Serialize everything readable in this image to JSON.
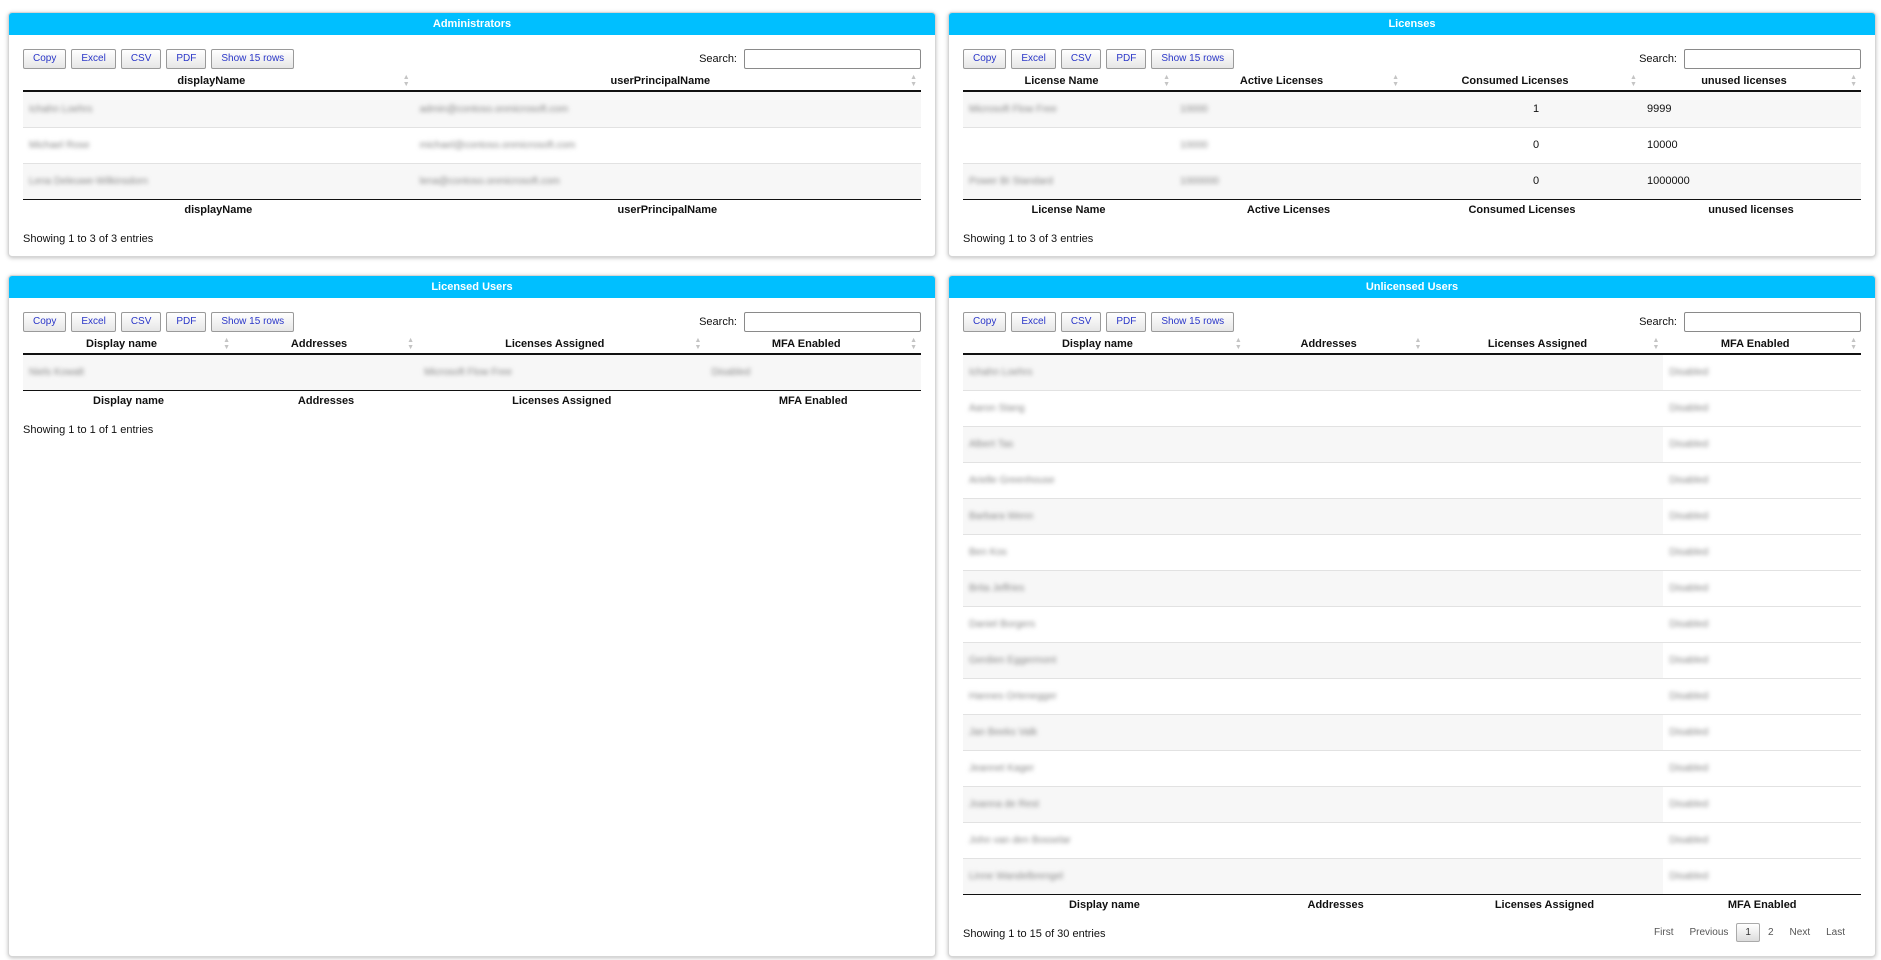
{
  "toolbar": {
    "copy": "Copy",
    "excel": "Excel",
    "csv": "CSV",
    "pdf": "PDF",
    "show_rows": "Show 15 rows",
    "search_label": "Search:"
  },
  "administrators": {
    "title": "Administrators",
    "columns": [
      "displayName",
      "userPrincipalName"
    ],
    "rows": [
      [
        "Ichahn Loehrs",
        "admin@contoso.onmicrosoft.com"
      ],
      [
        "Michael Rose",
        "michael@contoso.onmicrosoft.com"
      ],
      [
        "Lena Deleuwe-Wilkinsdorn",
        "lena@contoso.onmicrosoft.com"
      ]
    ],
    "info": "Showing 1 to 3 of 3 entries"
  },
  "licenses": {
    "title": "Licenses",
    "columns": [
      "License Name",
      "Active Licenses",
      "Consumed Licenses",
      "unused licenses"
    ],
    "rows": [
      [
        "Microsoft Flow Free",
        "10000",
        "1",
        "9999"
      ],
      [
        "",
        "10000",
        "0",
        "10000"
      ],
      [
        "Power BI Standard",
        "1000000",
        "0",
        "1000000"
      ]
    ],
    "info": "Showing 1 to 3 of 3 entries"
  },
  "licensed_users": {
    "title": "Licensed Users",
    "columns": [
      "Display name",
      "Addresses",
      "Licenses Assigned",
      "MFA Enabled"
    ],
    "rows": [
      [
        "Niels Kowalt",
        "",
        "Microsoft Flow Free",
        "Disabled"
      ]
    ],
    "info": "Showing 1 to 1 of 1 entries"
  },
  "unlicensed_users": {
    "title": "Unlicensed Users",
    "columns": [
      "Display name",
      "Addresses",
      "Licenses Assigned",
      "MFA Enabled"
    ],
    "rows": [
      [
        "Ichahn Loehrs",
        "",
        "",
        "Disabled"
      ],
      [
        "Aaron Stang",
        "",
        "",
        "Disabled"
      ],
      [
        "Albert Tas",
        "",
        "",
        "Disabled"
      ],
      [
        "Arielle Greenhouse",
        "",
        "",
        "Disabled"
      ],
      [
        "Barbara Wenn",
        "",
        "",
        "Disabled"
      ],
      [
        "Ben Kos",
        "",
        "",
        "Disabled"
      ],
      [
        "Brita Jeffries",
        "",
        "",
        "Disabled"
      ],
      [
        "Daniel Borgers",
        "",
        "",
        "Disabled"
      ],
      [
        "Gerdien Eggermont",
        "",
        "",
        "Disabled"
      ],
      [
        "Hannes Ortenegger",
        "",
        "",
        "Disabled"
      ],
      [
        "Jan Beeks Valk",
        "",
        "",
        "Disabled"
      ],
      [
        "Jeannet Kager",
        "",
        "",
        "Disabled"
      ],
      [
        "Joanna de Rest",
        "",
        "",
        "Disabled"
      ],
      [
        "John van den Bosselar",
        "",
        "",
        "Disabled"
      ],
      [
        "Linne Wandelbrengel",
        "",
        "",
        "Disabled"
      ]
    ],
    "info": "Showing 1 to 15 of 30 entries",
    "pager": {
      "first": "First",
      "previous": "Previous",
      "pages": [
        "1",
        "2"
      ],
      "next": "Next",
      "last": "Last"
    }
  }
}
